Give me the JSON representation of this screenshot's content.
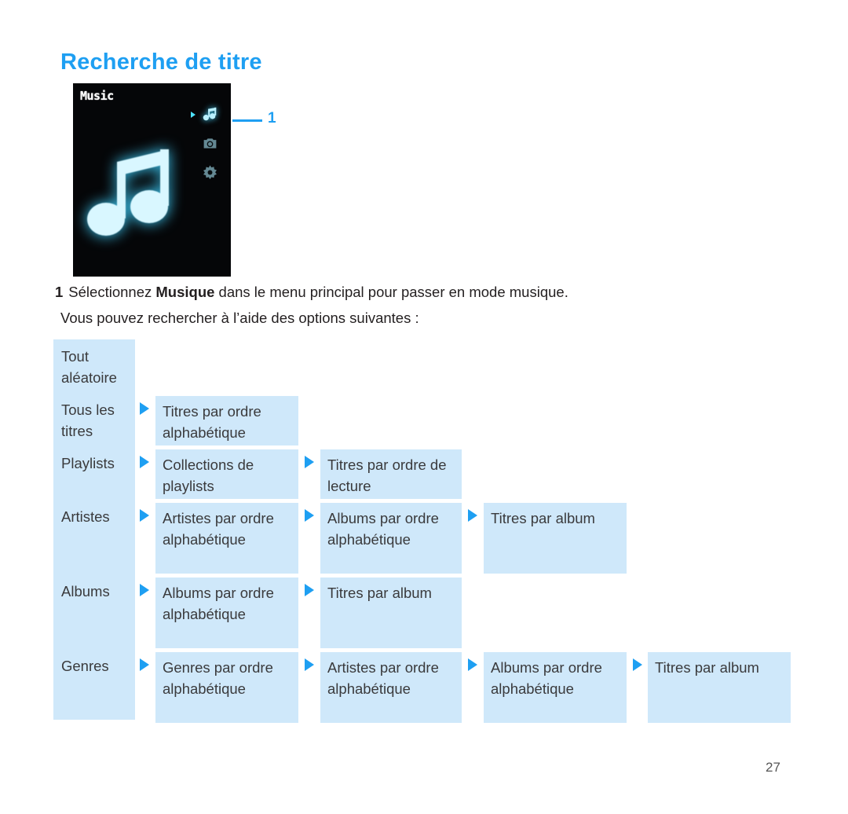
{
  "heading": "Recherche de titre",
  "device": {
    "title": "Music",
    "icons": [
      {
        "name": "music-note-icon",
        "selected": true
      },
      {
        "name": "camera-icon",
        "selected": false
      },
      {
        "name": "gear-icon",
        "selected": false
      }
    ]
  },
  "callout": {
    "number": "1"
  },
  "step": {
    "number": "1",
    "before": "Sélectionnez ",
    "strong": "Musique",
    "after": " dans le menu principal pour passer en mode musique."
  },
  "intro": "Vous pouvez rechercher à l’aide des options suivantes :",
  "flow": {
    "rows": [
      {
        "label": "Tout aléatoire",
        "cells": []
      },
      {
        "label": "Tous les titres",
        "cells": [
          "Titres par ordre alphabétique"
        ]
      },
      {
        "label": "Playlists",
        "cells": [
          "Collections de playlists",
          "Titres par ordre de lecture"
        ]
      },
      {
        "label": "Artistes",
        "cells": [
          "Artistes par ordre alphabétique",
          "Albums par ordre alphabétique",
          "Titres par album"
        ]
      },
      {
        "label": "Albums",
        "cells": [
          "Albums par ordre alphabétique",
          "Titres par album"
        ]
      },
      {
        "label": "Genres",
        "cells": [
          "Genres par ordre alphabétique",
          "Artistes par ordre alphabétique",
          "Albums par ordre alphabétique",
          "Titres par album"
        ]
      }
    ]
  },
  "page_number": "27",
  "colors": {
    "accent": "#1e9ff2",
    "cell_fill": "#cfe8fa",
    "text": "#3a3a3c",
    "device_bg": "#050608",
    "device_glow": "#49d8ff"
  }
}
